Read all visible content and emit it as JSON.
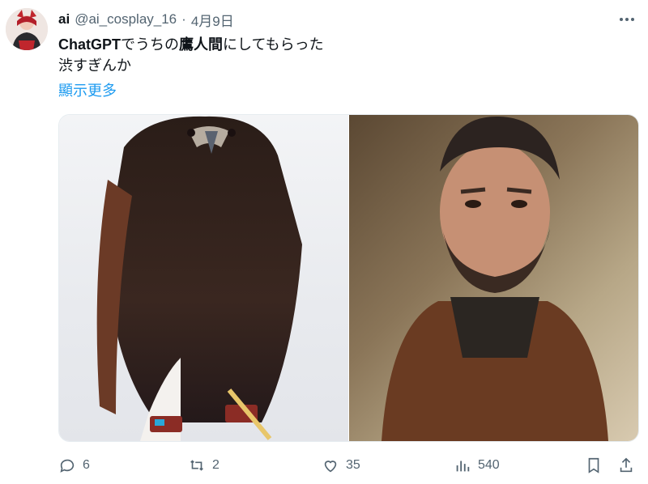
{
  "tweet": {
    "display_name": "ai",
    "handle": "@ai_cosplay_16",
    "separator": "·",
    "date": "4月9日",
    "text_line1_a": "ChatGPT",
    "text_line1_b": "でうちの",
    "text_line1_c": "鷹人間",
    "text_line1_d": "にしてもらった",
    "text_line2": "渋すぎんか",
    "show_more": "顯示更多"
  },
  "media": {
    "left_image": "hawk-photo",
    "right_image": "bearded-man-leather-jacket-photo"
  },
  "actions": {
    "replies": "6",
    "reposts": "2",
    "likes": "35",
    "views": "540"
  },
  "colors": {
    "accent": "#1d9bf0",
    "muted": "#536471",
    "text": "#0f1419"
  }
}
